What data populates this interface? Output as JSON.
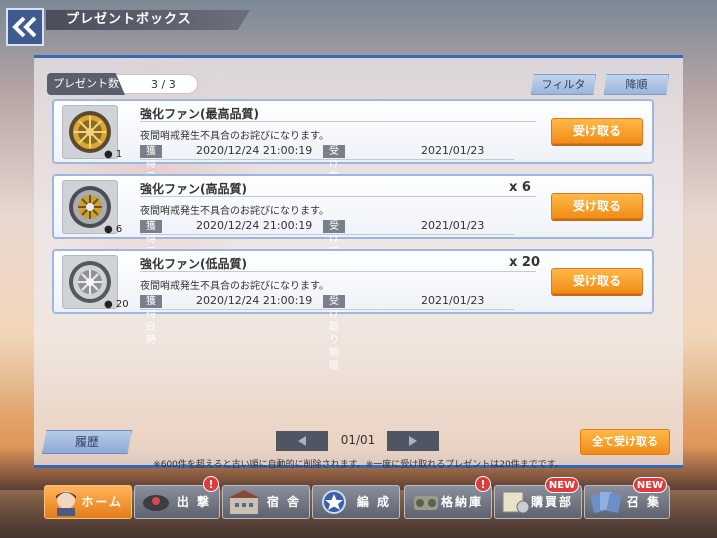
{
  "header": {
    "title": "プレゼントボックス"
  },
  "panel": {
    "count_label": "プレゼント数",
    "count_value": "3 / 3",
    "filter_label": "フィルタ",
    "sort_label": "降順"
  },
  "items": [
    {
      "name": "強化ファン(最高品質)",
      "count": "",
      "badge": "1",
      "desc": "夜間哨戒発生不具合のお詫びになります。",
      "acquired_label": "獲得日時",
      "acquired_at": "2020/12/24 21:00:19",
      "deadline_label": "受け取り期限",
      "deadline": "2021/01/23",
      "receive_label": "受け取る"
    },
    {
      "name": "強化ファン(高品質)",
      "count": "x 6",
      "badge": "6",
      "desc": "夜間哨戒発生不具合のお詫びになります。",
      "acquired_label": "獲得日時",
      "acquired_at": "2020/12/24 21:00:19",
      "deadline_label": "受け取り期限",
      "deadline": "2021/01/23",
      "receive_label": "受け取る"
    },
    {
      "name": "強化ファン(低品質)",
      "count": "x 20",
      "badge": "20",
      "desc": "夜間哨戒発生不具合のお詫びになります。",
      "acquired_label": "獲得日時",
      "acquired_at": "2020/12/24 21:00:19",
      "deadline_label": "受け取り期限",
      "deadline": "2021/01/23",
      "receive_label": "受け取る"
    }
  ],
  "footer": {
    "history_label": "履歴",
    "page": "01/01",
    "receive_all_label": "全て受け取る",
    "note": "※600件を超えると古い順に自動的に削除されます。※一度に受け取れるプレゼントは20件までです。"
  },
  "nav": {
    "home": "ホーム",
    "sortie": "出 撃",
    "dorm": "宿 舎",
    "formation": "編 成",
    "hangar": "格納庫",
    "shop": "購買部",
    "recruit": "召 集",
    "alert_mark": "!",
    "new_mark": "NEW"
  }
}
